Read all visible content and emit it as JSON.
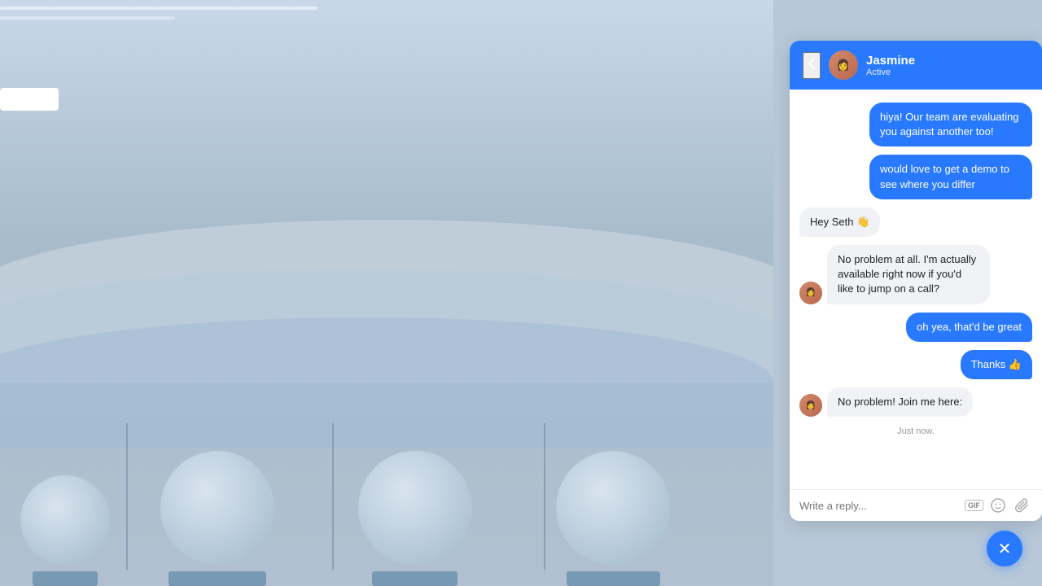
{
  "background": {
    "description": "Blueish gray watercolor background with product cards"
  },
  "chat": {
    "header": {
      "back_label": "‹",
      "agent_name": "Jasmine",
      "agent_status": "Active"
    },
    "messages": [
      {
        "id": "msg1",
        "type": "sent",
        "text": "hiya! Our team are evaluating you against another too!"
      },
      {
        "id": "msg2",
        "type": "sent",
        "text": "would love to get a demo to see where you differ"
      },
      {
        "id": "msg3",
        "type": "received-plain",
        "text": "Hey Seth 👋"
      },
      {
        "id": "msg4",
        "type": "received-avatar",
        "text": "No problem at all. I'm actually available right now if you'd like to jump on a call?"
      },
      {
        "id": "msg5",
        "type": "sent",
        "text": "oh yea, that'd be great"
      },
      {
        "id": "msg6",
        "type": "sent",
        "text": "Thanks 👍"
      },
      {
        "id": "msg7",
        "type": "received-avatar",
        "text": "No problem! Join me here:"
      }
    ],
    "timestamp": "Just now.",
    "input_placeholder": "Write a reply...",
    "close_button_label": "×"
  },
  "icons": {
    "gif": "GIF",
    "emoji": "😊",
    "attachment": "📎",
    "back": "‹",
    "close": "✕"
  }
}
